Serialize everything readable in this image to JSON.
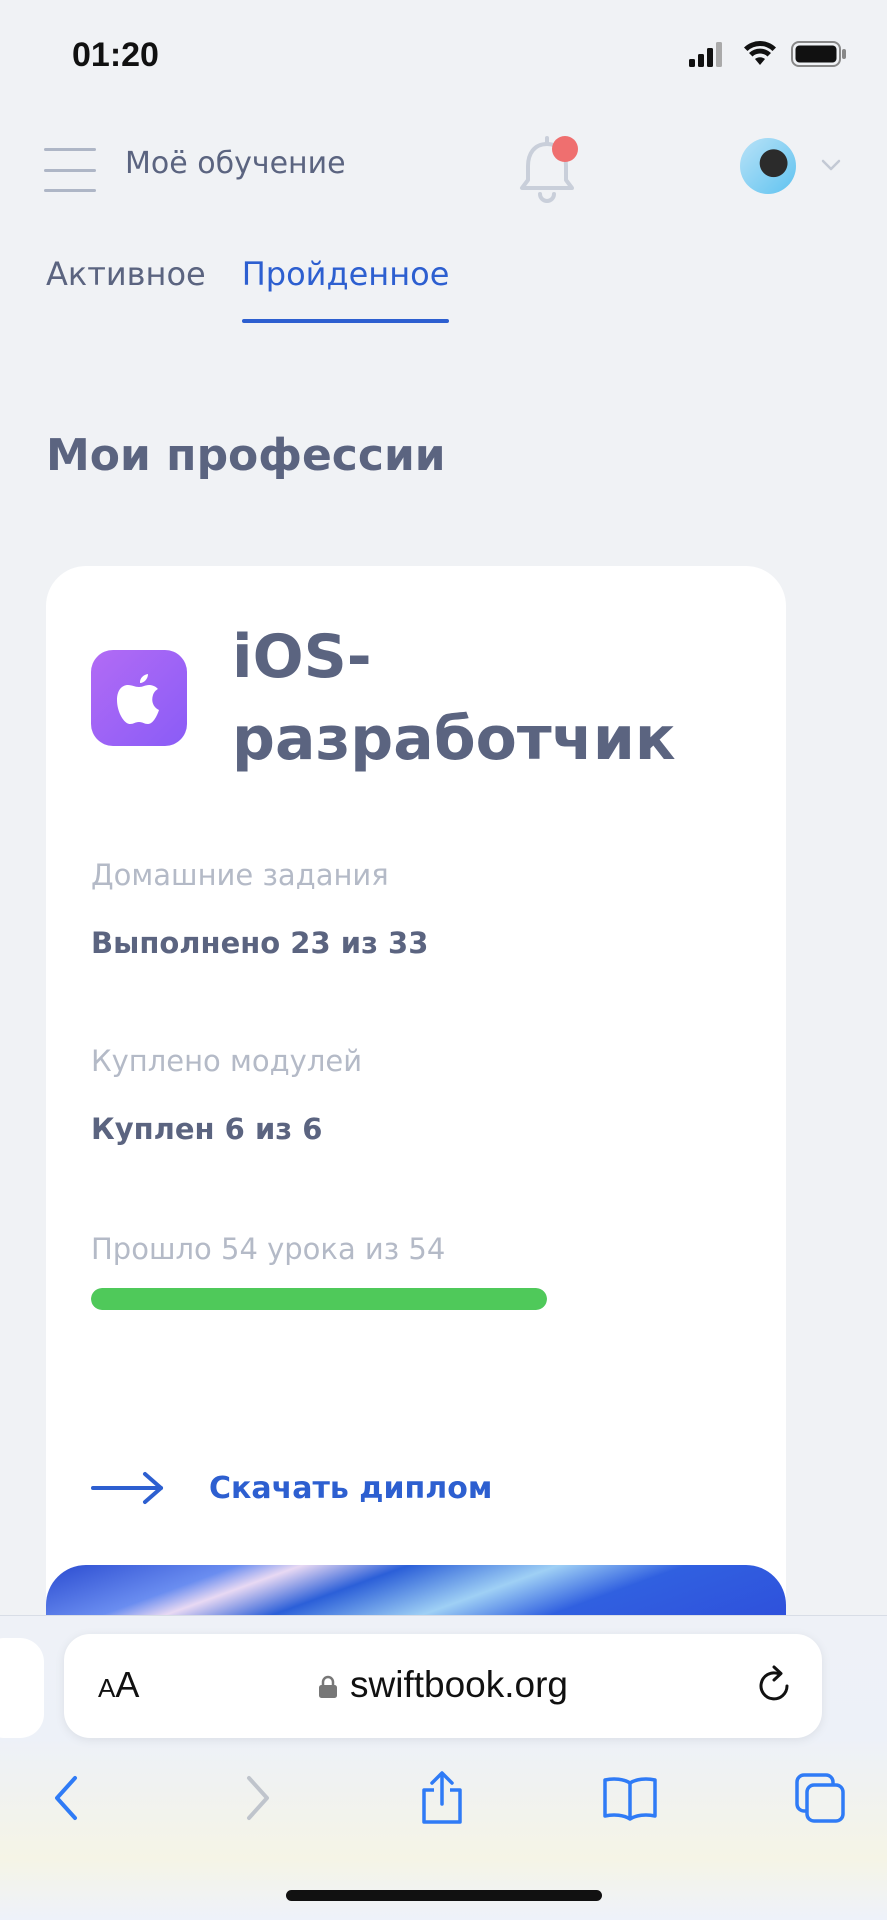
{
  "status_bar": {
    "time": "01:20"
  },
  "header": {
    "title": "Моё обучение"
  },
  "tabs": [
    {
      "label": "Активное",
      "active": false
    },
    {
      "label": "Пройденное",
      "active": true
    }
  ],
  "section_title": "Мои профессии",
  "profession": {
    "title": "iOS-разработчик",
    "homework_label": "Домашние задания",
    "homework_value": "Выполнено 23 из 33",
    "modules_label": "Куплено модулей",
    "modules_value": "Куплен 6 из 6",
    "lessons_label": "Прошло 54 урока из 54",
    "lessons_progress": 1.0,
    "download_label": "Скачать диплом"
  },
  "browser": {
    "aa_label_small": "A",
    "aa_label_large": "A",
    "url": "swiftbook.org"
  },
  "colors": {
    "accent": "#2d5fd0",
    "text": "#5b6480",
    "muted": "#b4bac7",
    "progress": "#4fc95a",
    "notification_dot": "#ef6f6f",
    "app_icon": "#9b62f6"
  },
  "icons": [
    "signal-icon",
    "wifi-icon",
    "battery-icon",
    "menu-icon",
    "bell-icon",
    "avatar",
    "chevron-down-icon",
    "apple-icon",
    "arrow-right-icon",
    "lock-icon",
    "reload-icon",
    "back-icon",
    "forward-icon",
    "share-icon",
    "bookmarks-icon",
    "tabs-icon"
  ]
}
